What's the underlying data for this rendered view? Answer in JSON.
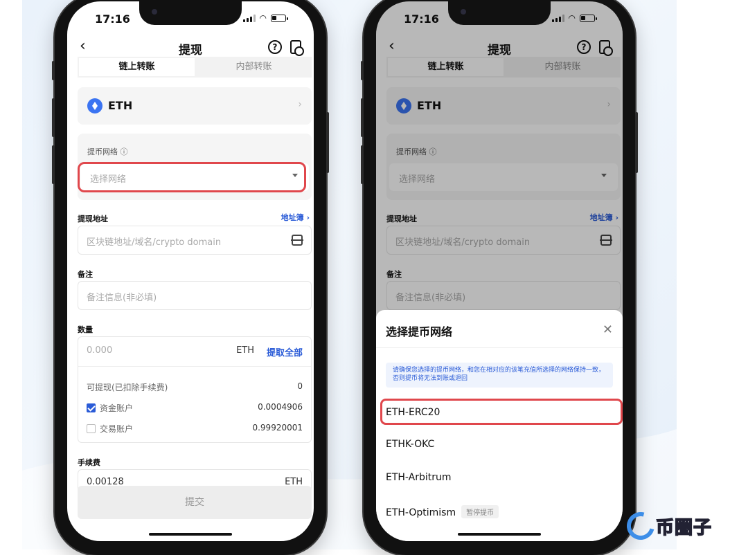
{
  "status": {
    "time": "17:16"
  },
  "nav": {
    "title": "提现",
    "back_icon": "chevron-left-icon",
    "help_icon": "help-circle-icon",
    "records_icon": "records-icon"
  },
  "tabs": [
    {
      "label": "链上转账",
      "active": true
    },
    {
      "label": "内部转账",
      "active": false
    }
  ],
  "coin": {
    "name": "ETH",
    "chevron": "›"
  },
  "network": {
    "label": "提币网络 ⓘ",
    "placeholder": "选择网络"
  },
  "address": {
    "label": "提现地址",
    "book_link": "地址簿 ›",
    "placeholder": "区块链地址/域名/crypto domain"
  },
  "memo": {
    "label": "备注",
    "placeholder": "备注信息(非必填)"
  },
  "amount": {
    "label": "数量",
    "placeholder": "0.000",
    "unit": "ETH",
    "max_button": "提取全部",
    "available_label": "可提现(已扣除手续费)",
    "available_value": "0",
    "accounts": [
      {
        "label": "资金账户",
        "value": "0.0004906",
        "checked": true
      },
      {
        "label": "交易账户",
        "value": "0.99920001",
        "checked": false
      }
    ]
  },
  "fee": {
    "label": "手续费",
    "value": "0.00128",
    "unit": "ETH"
  },
  "submit_label": "提交",
  "sheet": {
    "title": "选择提币网络",
    "close": "✕",
    "notice": "请确保您选择的提币网络，和您在相对应的该笔充值所选择的网络保持一致，否则提币将无法到账或退回",
    "options": [
      {
        "label": "ETH-ERC20",
        "badge": ""
      },
      {
        "label": "ETHK-OKC",
        "badge": ""
      },
      {
        "label": "ETH-Arbitrum",
        "badge": ""
      },
      {
        "label": "ETH-Optimism",
        "badge": "暂停提币"
      }
    ]
  },
  "watermark": "币圈子",
  "colors": {
    "accent": "#2a5bd7",
    "highlight": "#e0474c",
    "eth": "#3b74f2"
  }
}
